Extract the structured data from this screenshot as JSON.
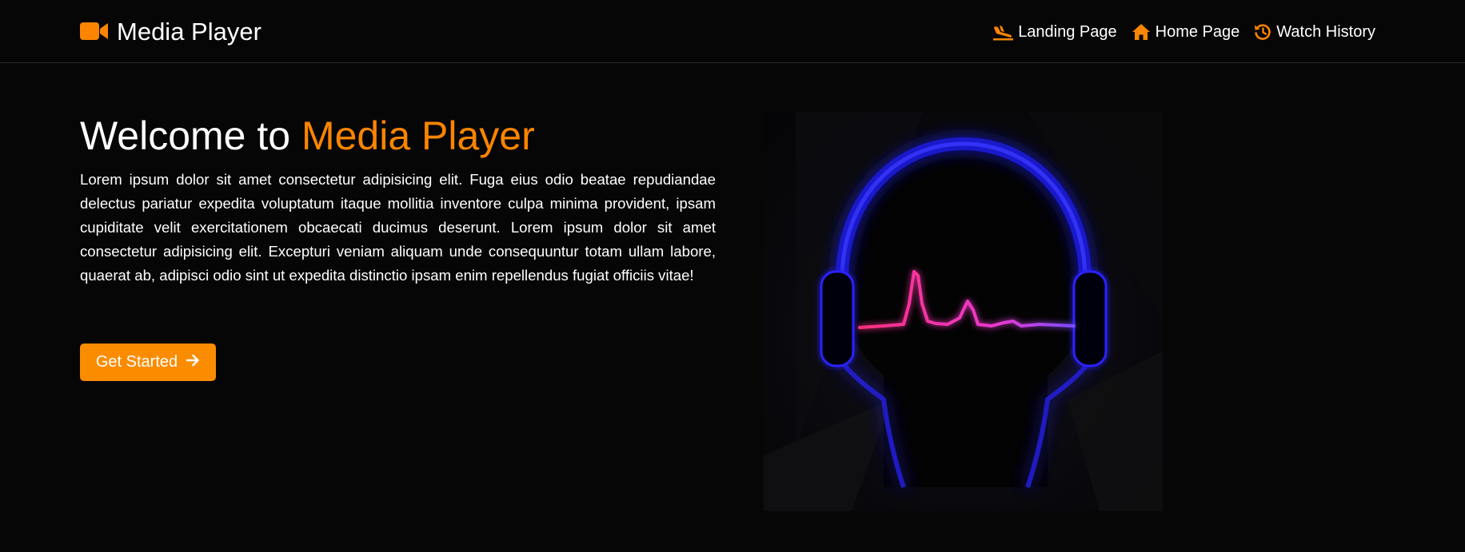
{
  "colors": {
    "accent": "#fb8500",
    "button": "#fb8c00",
    "background": "#060606",
    "text": "#ffffff",
    "headphone_glow": "#2a23ff",
    "waveform": "#ff2fa0"
  },
  "navbar": {
    "brand": {
      "icon": "video-camera-icon",
      "label": "Media Player"
    },
    "links": [
      {
        "icon": "plane-landing-icon",
        "label": "Landing Page"
      },
      {
        "icon": "house-icon",
        "label": "Home Page"
      },
      {
        "icon": "history-icon",
        "label": "Watch History"
      }
    ]
  },
  "hero": {
    "title_prefix": "Welcome to ",
    "title_accent": "Media Player",
    "description": "Lorem ipsum dolor sit amet consectetur adipisicing elit. Fuga eius odio beatae repudiandae delectus pariatur expedita voluptatum itaque mollitia inventore culpa minima provident, ipsam cupiditate velit exercitationem obcaecati ducimus deserunt. Lorem ipsum dolor sit amet consectetur adipisicing elit. Excepturi veniam aliquam unde consequuntur totam ullam labore, quaerat ab, adipisci odio sint ut expedita distinctio ipsam enim repellendus fugiat officiis vitae!",
    "button": {
      "label": "Get Started",
      "icon": "arrow-right-icon"
    },
    "image": {
      "subject": "headphones silhouette with heartbeat waveform"
    }
  }
}
